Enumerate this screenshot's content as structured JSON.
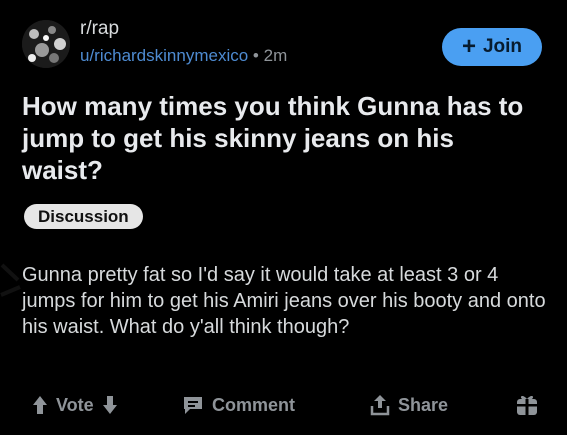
{
  "post": {
    "subreddit": "r/rap",
    "username": "u/richardskinnymexico",
    "separator": "•",
    "age": "2m",
    "join_label": "Join",
    "title": "How many times you think Gunna has to jump to get his skinny jeans on his waist?",
    "flair": "Discussion",
    "body": "Gunna pretty fat so I'd say it would take at least 3 or 4 jumps for him to get his Amiri jeans over his booty and onto his waist. What do y'all think though?"
  },
  "actions": {
    "vote_label": "Vote",
    "comment_label": "Comment",
    "share_label": "Share"
  },
  "colors": {
    "background": "#000000",
    "join_button": "#4a9ff2",
    "username": "#4e8bd1",
    "flair_bg": "#e6e6e6"
  },
  "icons": [
    "upvote-icon",
    "downvote-icon",
    "comment-icon",
    "share-icon",
    "award-icon",
    "plus-icon"
  ]
}
